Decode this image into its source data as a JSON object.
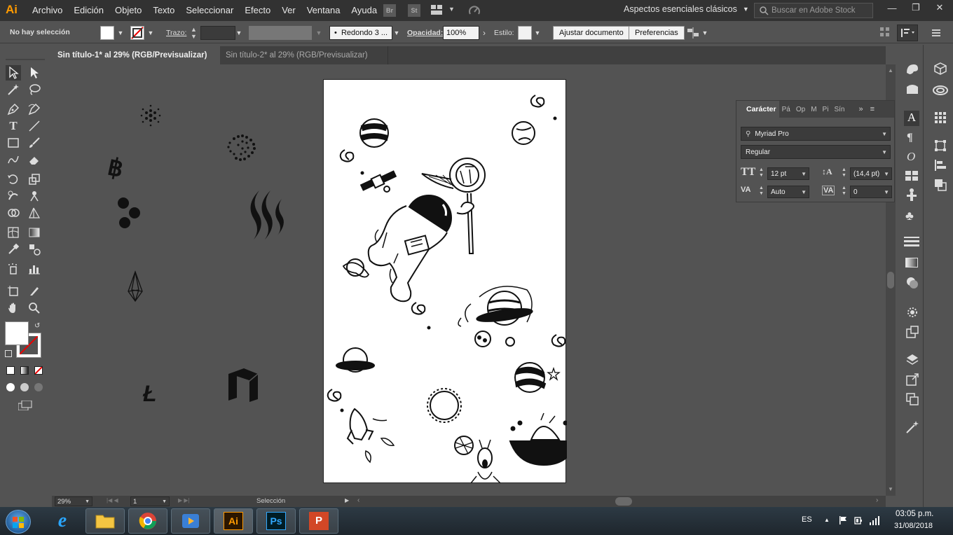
{
  "app": {
    "logo": "Ai"
  },
  "menu": [
    "Archivo",
    "Edición",
    "Objeto",
    "Texto",
    "Seleccionar",
    "Efecto",
    "Ver",
    "Ventana",
    "Ayuda"
  ],
  "bridge": {
    "br": "Br",
    "st": "St"
  },
  "workspace": "Aspectos esenciales clásicos",
  "search": {
    "placeholder": "Buscar en Adobe Stock"
  },
  "control": {
    "selection": "No hay selección",
    "stroke_label": "Trazo:",
    "brush": "Redondo 3 ...",
    "opacity_label": "Opacidad:",
    "opacity_value": "100%",
    "style_label": "Estilo:",
    "fit_button": "Ajustar documento",
    "prefs_button": "Preferencias"
  },
  "tabs": [
    {
      "label": "Sin título-1* al 29% (RGB/Previsualizar)",
      "active": true
    },
    {
      "label": "Sin título-2* al 29% (RGB/Previsualizar)",
      "active": false
    }
  ],
  "char_panel": {
    "tabs": [
      "Carácter",
      "Pá",
      "Op",
      "M",
      "Pi",
      "Sín"
    ],
    "font": "Myriad Pro",
    "style": "Regular",
    "size": "12 pt",
    "leading": "(14,4 pt)",
    "kerning": "Auto",
    "tracking": "0"
  },
  "status": {
    "zoom": "29%",
    "page": "1",
    "tool": "Selección"
  },
  "taskbar": {
    "lang": "ES",
    "time": "03:05 p.m.",
    "date": "31/08/2018"
  },
  "colors": {
    "accent": "#ff9a00",
    "ui_dark": "#323232",
    "ui_mid": "#535353"
  }
}
